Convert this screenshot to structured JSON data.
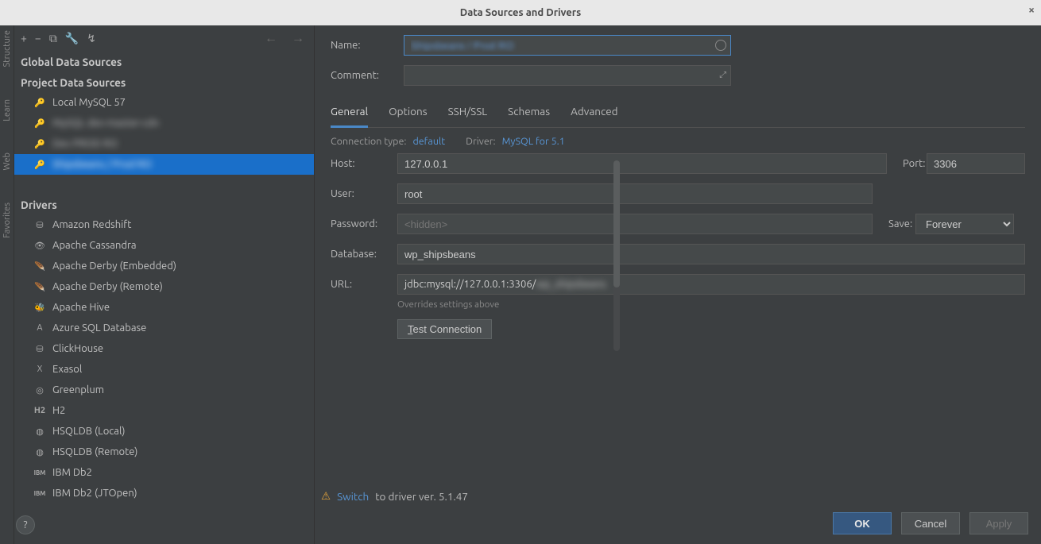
{
  "title": "Data Sources and Drivers",
  "gutter": {
    "a": "Structure",
    "b": "Learn",
    "c": "Web",
    "d": "Favorites"
  },
  "toolbar": {
    "add": "+",
    "remove": "−",
    "copy": "⧉",
    "settings": "🔧",
    "reset": "↯",
    "back": "←",
    "forward": "→"
  },
  "sections": {
    "global": "Global Data Sources",
    "project": "Project Data Sources",
    "drivers": "Drivers"
  },
  "datasources": {
    "items": [
      {
        "label": "Local MySQL 57",
        "selected": false,
        "blur": false
      },
      {
        "label": "MySQL dev-master-cdn",
        "selected": false,
        "blur": true
      },
      {
        "label": "Dev PROD RO",
        "selected": false,
        "blur": true
      },
      {
        "label": "Shipsbeans / Prod RO",
        "selected": true,
        "blur": true
      }
    ]
  },
  "drivers": [
    "Amazon Redshift",
    "Apache Cassandra",
    "Apache Derby (Embedded)",
    "Apache Derby (Remote)",
    "Apache Hive",
    "Azure SQL Database",
    "ClickHouse",
    "Exasol",
    "Greenplum",
    "H2",
    "HSQLDB (Local)",
    "HSQLDB (Remote)",
    "IBM Db2",
    "IBM Db2 (JTOpen)"
  ],
  "form": {
    "name_label": "Name:",
    "name_value": "Shipsbeans / Prod RO",
    "comment_label": "Comment:",
    "tabs": [
      "General",
      "Options",
      "SSH/SSL",
      "Schemas",
      "Advanced"
    ],
    "conn_type_k": "Connection type:",
    "conn_type_v": "default",
    "driver_k": "Driver:",
    "driver_v": "MySQL for 5.1",
    "host_label": "Host:",
    "host_value": "127.0.0.1",
    "port_label": "Port:",
    "port_value": "3306",
    "user_label": "User:",
    "user_value": "root",
    "password_label": "Password:",
    "password_placeholder": "<hidden>",
    "save_label": "Save:",
    "save_value": "Forever",
    "database_label": "Database:",
    "database_value": "wp_shipsbeans",
    "url_label": "URL:",
    "url_value_a": "jdbc:mysql://127.0.0.1:3306/",
    "url_value_b": "wp_shipsbeans",
    "url_hint": "Overrides settings above",
    "test_btn_pre": "T",
    "test_btn_rest": "est Connection"
  },
  "footer": {
    "switch": "Switch",
    "rest": " to driver ver. 5.1.47",
    "ok": "OK",
    "cancel": "Cancel",
    "apply": "Apply",
    "help": "?"
  }
}
